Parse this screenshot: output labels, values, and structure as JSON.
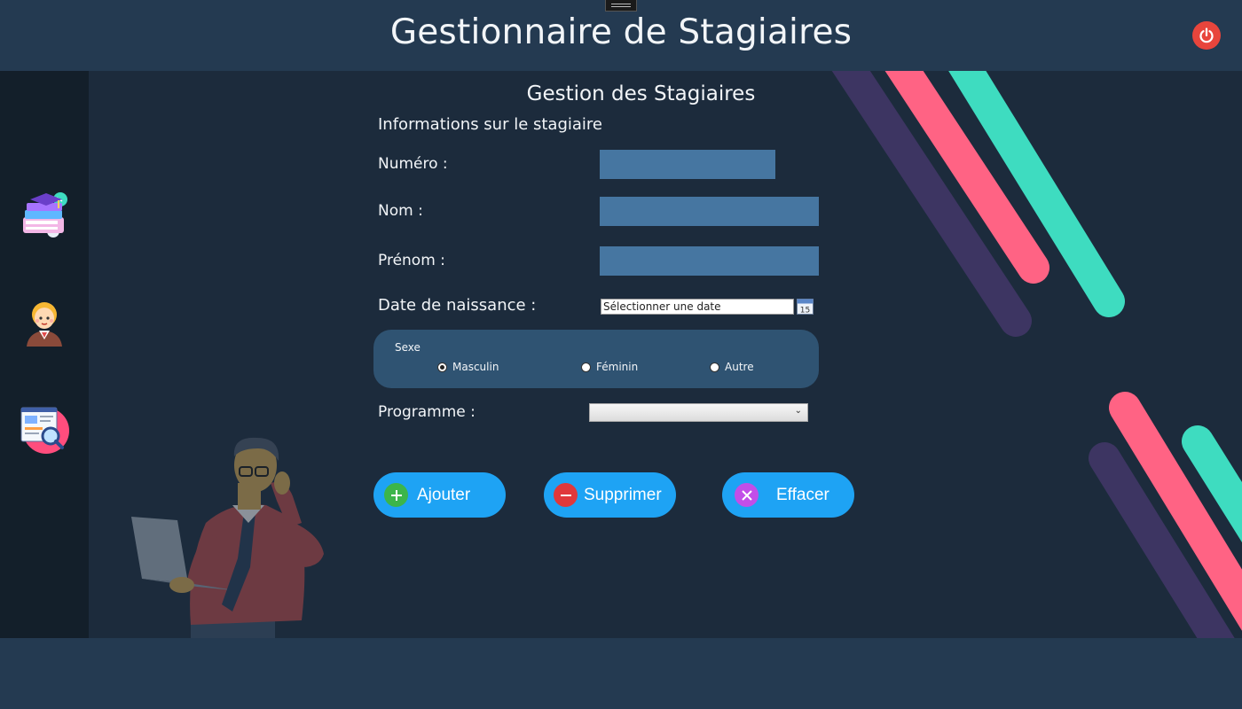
{
  "header": {
    "title": "Gestionnaire de Stagiaires",
    "power_icon": "power-icon"
  },
  "sidebar": {
    "items": [
      {
        "name": "formations",
        "icon": "books-graduation-icon"
      },
      {
        "name": "stagiaires",
        "icon": "student-avatar-icon"
      },
      {
        "name": "recherche",
        "icon": "search-document-icon"
      }
    ]
  },
  "form": {
    "title": "Gestion des Stagiaires",
    "section_title": "Informations sur le stagiaire",
    "numero_label": "Numéro  :",
    "numero_value": "",
    "nom_label": "Nom  :",
    "nom_value": "",
    "prenom_label": "Prénom :",
    "prenom_value": "",
    "date_label": "Date de naissance :",
    "date_placeholder": "Sélectionner une date",
    "calendar_day": "15",
    "sexe": {
      "legend": "Sexe",
      "options": [
        {
          "label": "Masculin",
          "checked": true
        },
        {
          "label": "Féminin",
          "checked": false
        },
        {
          "label": "Autre",
          "checked": false
        }
      ]
    },
    "programme_label": "Programme :",
    "programme_value": ""
  },
  "buttons": {
    "add_label": "Ajouter",
    "delete_label": "Supprimer",
    "clear_label": "Effacer"
  },
  "colors": {
    "background": "#1c2b3c",
    "header": "#243a51",
    "sidebar": "#131f2a",
    "field": "#4676a1",
    "button": "#1ea3f4",
    "accent_pink": "#ff6384",
    "accent_teal": "#3edcc0",
    "accent_purple": "#3d3562"
  }
}
